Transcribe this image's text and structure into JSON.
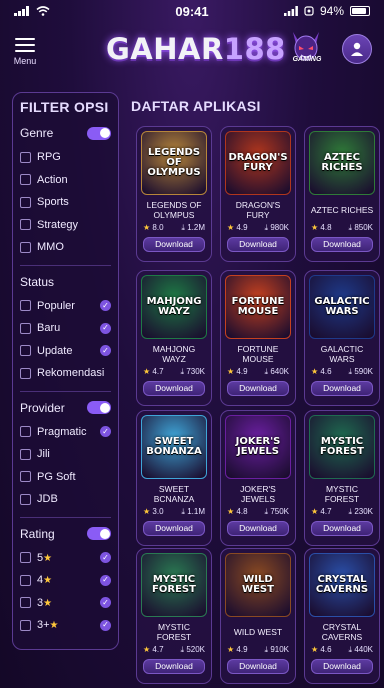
{
  "status_bar": {
    "time": "09:41",
    "battery": "94%"
  },
  "header": {
    "menu_label": "Menu",
    "logo_main": "GAHAR",
    "logo_num": "188",
    "badge_text": "GAMING"
  },
  "sidebar": {
    "title": "FILTER OPSI",
    "genre": {
      "label": "Genre",
      "options": [
        "RPG",
        "Action",
        "Sports",
        "Strategy",
        "MMO"
      ]
    },
    "status": {
      "label": "Status",
      "options": [
        "Populer",
        "Baru",
        "Update",
        "Rekomendasi"
      ]
    },
    "provider": {
      "label": "Provider",
      "options": [
        "Pragmatic",
        "Jili",
        "PG Soft",
        "JDB"
      ]
    },
    "rating": {
      "label": "Rating",
      "options": [
        "5",
        "4",
        "3",
        "3+"
      ]
    }
  },
  "main": {
    "title": "DAFTAR APLIKASI",
    "download_label": "Download",
    "apps": [
      {
        "name": "LEGENDS OF OLYMPUS",
        "thumb": "LEGENDS OF OLYMPUS",
        "rating": "8.0",
        "downloads": "1.2M",
        "bg": "#b7863a"
      },
      {
        "name": "DRAGON'S FURY",
        "thumb": "DRAGON'S FURY",
        "rating": "4.9",
        "downloads": "980K",
        "bg": "#b0361d"
      },
      {
        "name": "AZTEC RICHES",
        "thumb": "AZTEC RICHES",
        "rating": "4.8",
        "downloads": "850K",
        "bg": "#2f7b38"
      },
      {
        "name": "MAHJONG WAYZ",
        "thumb": "MAHJONG WAYZ",
        "rating": "4.7",
        "downloads": "730K",
        "bg": "#1e7a45"
      },
      {
        "name": "FORTUNE MOUSE",
        "thumb": "FORTUNE MOUSE",
        "rating": "4.9",
        "downloads": "640K",
        "bg": "#c5411f"
      },
      {
        "name": "GALACTIC WARS",
        "thumb": "GALACTIC WARS",
        "rating": "4.6",
        "downloads": "590K",
        "bg": "#1e3a8a"
      },
      {
        "name": "SWEET BCNANZA",
        "thumb": "SWEET BONANZA",
        "rating": "3.0",
        "downloads": "1.1M",
        "bg": "#3fa6d8"
      },
      {
        "name": "JOKER'S JEWELS",
        "thumb": "JOKER'S JEWELS",
        "rating": "4.8",
        "downloads": "750K",
        "bg": "#6a1fa0"
      },
      {
        "name": "MYSTIC FOREST",
        "thumb": "MYSTIC FOREST",
        "rating": "4.7",
        "downloads": "230K",
        "bg": "#1f6b50"
      },
      {
        "name": "MYSTIC FOREST",
        "thumb": "MYSTIC FOREST",
        "rating": "4.7",
        "downloads": "520K",
        "bg": "#2a7a52"
      },
      {
        "name": "WILD WEST",
        "thumb": "WILD WEST",
        "rating": "4.9",
        "downloads": "910K",
        "bg": "#8a4a22"
      },
      {
        "name": "CRYSTAL CAVERNS",
        "thumb": "CRYSTAL CAVERNS",
        "rating": "4.6",
        "downloads": "440K",
        "bg": "#2a4fa8"
      }
    ]
  },
  "colors": {
    "accent": "#8a5cf5",
    "star": "#ffc83a",
    "background": "#1f0d3c"
  }
}
